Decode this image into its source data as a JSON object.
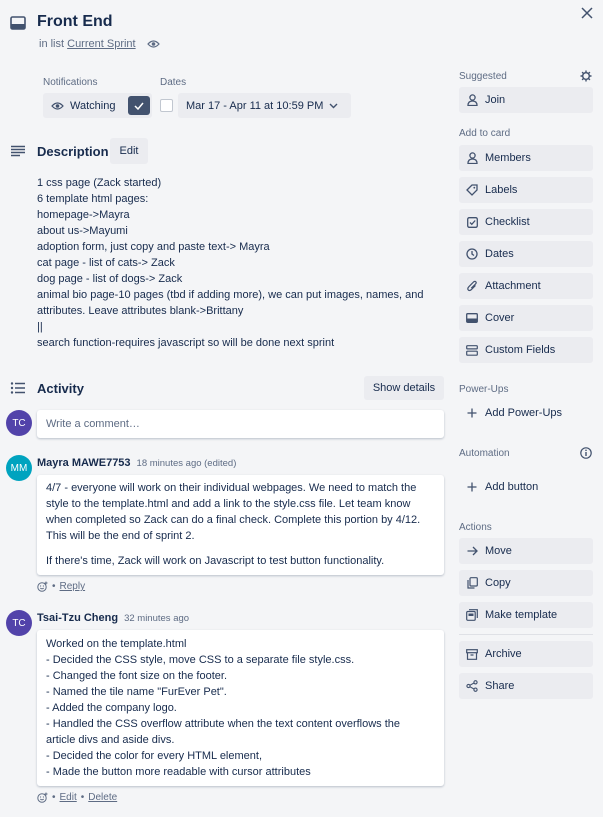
{
  "card": {
    "title": "Front End",
    "in_list_prefix": "in list",
    "list_name": "Current Sprint"
  },
  "notifications": {
    "label": "Notifications",
    "button": "Watching"
  },
  "dates": {
    "label": "Dates",
    "value": "Mar 17 - Apr 11 at 10:59 PM"
  },
  "description": {
    "title": "Description",
    "edit_label": "Edit",
    "lines": [
      "1 css page (Zack started)",
      "6 template html pages:",
      "homepage->Mayra",
      "about us->Mayumi",
      "adoption form, just copy and paste text-> Mayra",
      "cat page - list of cats-> Zack",
      "dog page - list of dogs-> Zack",
      "animal bio page-10 pages (tbd if adding more), we can put images, names, and",
      "attributes. Leave attributes blank->Brittany",
      "||",
      "search function-requires javascript so will be done next sprint"
    ]
  },
  "activity": {
    "title": "Activity",
    "show_details": "Show details",
    "comment_placeholder": "Write a comment…",
    "current_user_initials": "TC",
    "comments": [
      {
        "initials": "MM",
        "author": "Mayra MAWE7753",
        "time": "18 minutes ago (edited)",
        "avatar_color": "#00a3bf",
        "lines": [
          "4/7 - everyone will work on their individual webpages. We need to match the",
          "style to the template.html and add a link to the style.css file. Let team know",
          "when completed so Zack can do a final check. Complete this portion by 4/12.",
          "This will be the end of sprint 2.",
          "",
          "If there's time, Zack will work on Javascript to test button functionality."
        ],
        "action1": "Reply"
      },
      {
        "initials": "TC",
        "author": "Tsai-Tzu Cheng",
        "time": "32 minutes ago",
        "avatar_color": "#5243aa",
        "lines": [
          "Worked on the template.html",
          "- Decided the CSS style, move CSS to a separate file style.css.",
          "- Changed the font size on the footer.",
          "- Named the tile name \"FurEver Pet\".",
          "- Added the company logo.",
          "- Handled the CSS overflow attribute when the text content overflows the",
          "article divs and aside divs.",
          "- Decided the color for every HTML element,",
          "- Made the button more readable with cursor attributes"
        ],
        "action1": "Edit",
        "action2": "Delete"
      }
    ]
  },
  "sidebar": {
    "suggested": "Suggested",
    "join": "Join",
    "add_to_card": "Add to card",
    "members": "Members",
    "labels": "Labels",
    "checklist": "Checklist",
    "dates": "Dates",
    "attachment": "Attachment",
    "cover": "Cover",
    "custom_fields": "Custom Fields",
    "power_ups": "Power-Ups",
    "add_power_ups": "Add Power-Ups",
    "automation": "Automation",
    "add_button": "Add button",
    "actions": "Actions",
    "move": "Move",
    "copy": "Copy",
    "make_template": "Make template",
    "archive": "Archive",
    "share": "Share"
  },
  "colors": {
    "accent": "#0079bf",
    "avatar_tc": "#5243aa",
    "avatar_mm": "#00a3bf",
    "watch_check": "#42526e"
  }
}
